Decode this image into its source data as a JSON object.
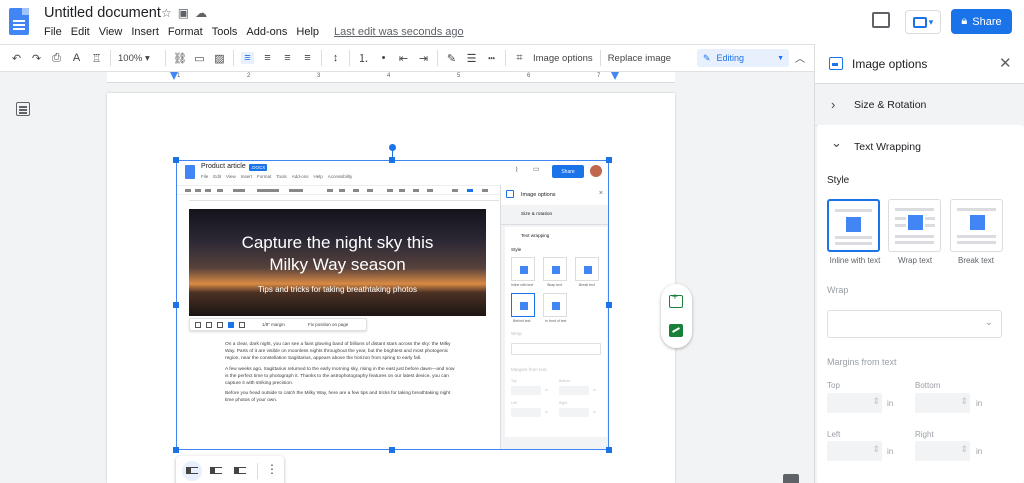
{
  "app": {
    "title": "Untitled document",
    "menu": [
      "File",
      "Edit",
      "View",
      "Insert",
      "Format",
      "Tools",
      "Add-ons",
      "Help"
    ],
    "last_edit": "Last edit was seconds ago",
    "share_label": "Share",
    "accent": "#1a73e8"
  },
  "toolbar": {
    "zoom": "100%",
    "image_options": "Image options",
    "replace_image": "Replace image",
    "mode": "Editing"
  },
  "ruler": {
    "labels": [
      "1",
      "2",
      "3",
      "4",
      "5",
      "6",
      "7"
    ]
  },
  "embedded": {
    "title": "Product article",
    "badge": ".DOCX",
    "menu": [
      "File",
      "Edit",
      "View",
      "Insert",
      "Format",
      "Tools",
      "Add-ons",
      "Help",
      "Accessibility"
    ],
    "share": "Share",
    "hero_title_1": "Capture the night sky this",
    "hero_title_2": "Milky Way season",
    "hero_subtitle": "Tips and tricks for taking breathtaking photos",
    "margin_select": "1/8\" margin",
    "position_select": "Fix position on page",
    "paragraphs": [
      "On a clear, dark night, you can see a faint glowing band of billions of distant stars across the sky: the Milky Way. Parts of it are visible on moonless nights throughout the year, but the brightest and most photogenic region, near the constellation Sagittarius, appears above the horizon from spring to early fall.",
      "A few weeks ago, Sagittarius returned to the early morning sky, rising in the east just before dawn—and now is the perfect time to photograph it. Thanks to the astrophotography features on our latest device, you can capture it with striking precision.",
      "Before you head outside to catch the Milky Way, here are a few tips and tricks for taking breathtaking night time photos of your own."
    ],
    "panel": {
      "title": "Image options",
      "size": "Size & rotation",
      "wrapping": "Text wrapping",
      "style": "Style",
      "opt_inline": "Inline with text",
      "opt_wrap": "Wrap text",
      "opt_break": "Break text",
      "opt_behind": "Behind text",
      "opt_front": "In front of text",
      "wrap": "Wrap",
      "margins": "Margins from text",
      "top": "Top",
      "bottom": "Bottom",
      "left": "Left",
      "right": "Right",
      "unit": "in"
    }
  },
  "panel": {
    "title": "Image options",
    "size_rotation": "Size & Rotation",
    "text_wrapping": "Text Wrapping",
    "style_label": "Style",
    "options": [
      {
        "label": "Inline with text",
        "selected": true
      },
      {
        "label": "Wrap text",
        "selected": false
      },
      {
        "label": "Break text",
        "selected": false
      }
    ],
    "wrap_label": "Wrap",
    "margins_label": "Margins from text",
    "top_label": "Top",
    "bottom_label": "Bottom",
    "left_label": "Left",
    "right_label": "Right",
    "unit": "in"
  }
}
